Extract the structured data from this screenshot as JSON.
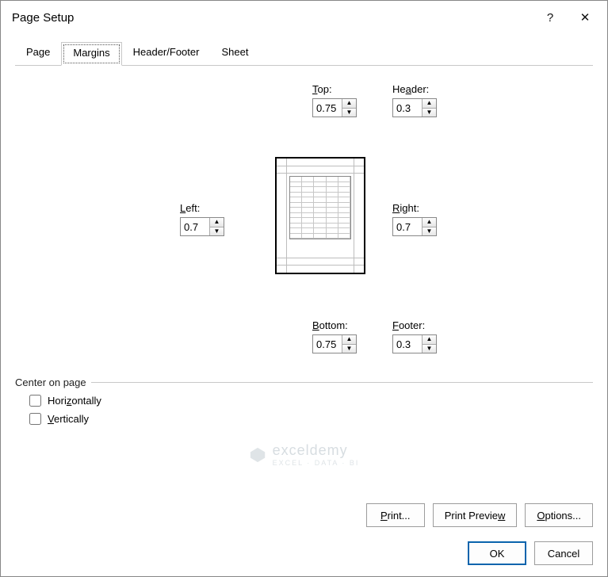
{
  "title": "Page Setup",
  "titlebar": {
    "help": "?",
    "close": "✕"
  },
  "tabs": {
    "page": "Page",
    "margins": "Margins",
    "headerfooter": "Header/Footer",
    "sheet": "Sheet"
  },
  "margins": {
    "top": {
      "label_pre": "",
      "label_u": "T",
      "label_post": "op:",
      "value": "0.75"
    },
    "header": {
      "label_pre": "He",
      "label_u": "a",
      "label_post": "der:",
      "value": "0.3"
    },
    "left": {
      "label_pre": "",
      "label_u": "L",
      "label_post": "eft:",
      "value": "0.7"
    },
    "right": {
      "label_pre": "",
      "label_u": "R",
      "label_post": "ight:",
      "value": "0.7"
    },
    "bottom": {
      "label_pre": "",
      "label_u": "B",
      "label_post": "ottom:",
      "value": "0.75"
    },
    "footer": {
      "label_pre": "",
      "label_u": "F",
      "label_post": "ooter:",
      "value": "0.3"
    }
  },
  "center": {
    "legend": "Center on page",
    "horizontally": {
      "pre": "Hori",
      "u": "z",
      "post": "ontally"
    },
    "vertically": {
      "pre": "",
      "u": "V",
      "post": "ertically"
    }
  },
  "buttons": {
    "print": "Print...",
    "preview_pre": "Print Previe",
    "preview_u": "w",
    "preview_post": "",
    "options_pre": "",
    "options_u": "O",
    "options_post": "ptions...",
    "ok": "OK",
    "cancel": "Cancel"
  },
  "watermark": {
    "name": "exceldemy",
    "sub": "EXCEL · DATA · BI"
  }
}
